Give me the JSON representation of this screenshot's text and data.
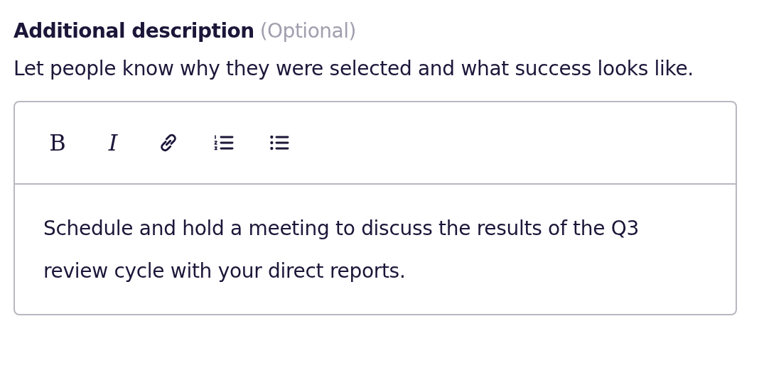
{
  "field": {
    "label": "Additional description",
    "optional": "(Optional)",
    "help": "Let people know why they were selected and what success looks like."
  },
  "toolbar": [
    {
      "kind": "bold",
      "label": "B"
    },
    {
      "kind": "italic",
      "label": "I"
    },
    {
      "kind": "link"
    },
    {
      "kind": "numbered-list"
    },
    {
      "kind": "bulleted-list"
    }
  ],
  "editor": {
    "value": "Schedule and hold a meeting to discuss the results of the Q3 review cycle with your direct reports."
  }
}
